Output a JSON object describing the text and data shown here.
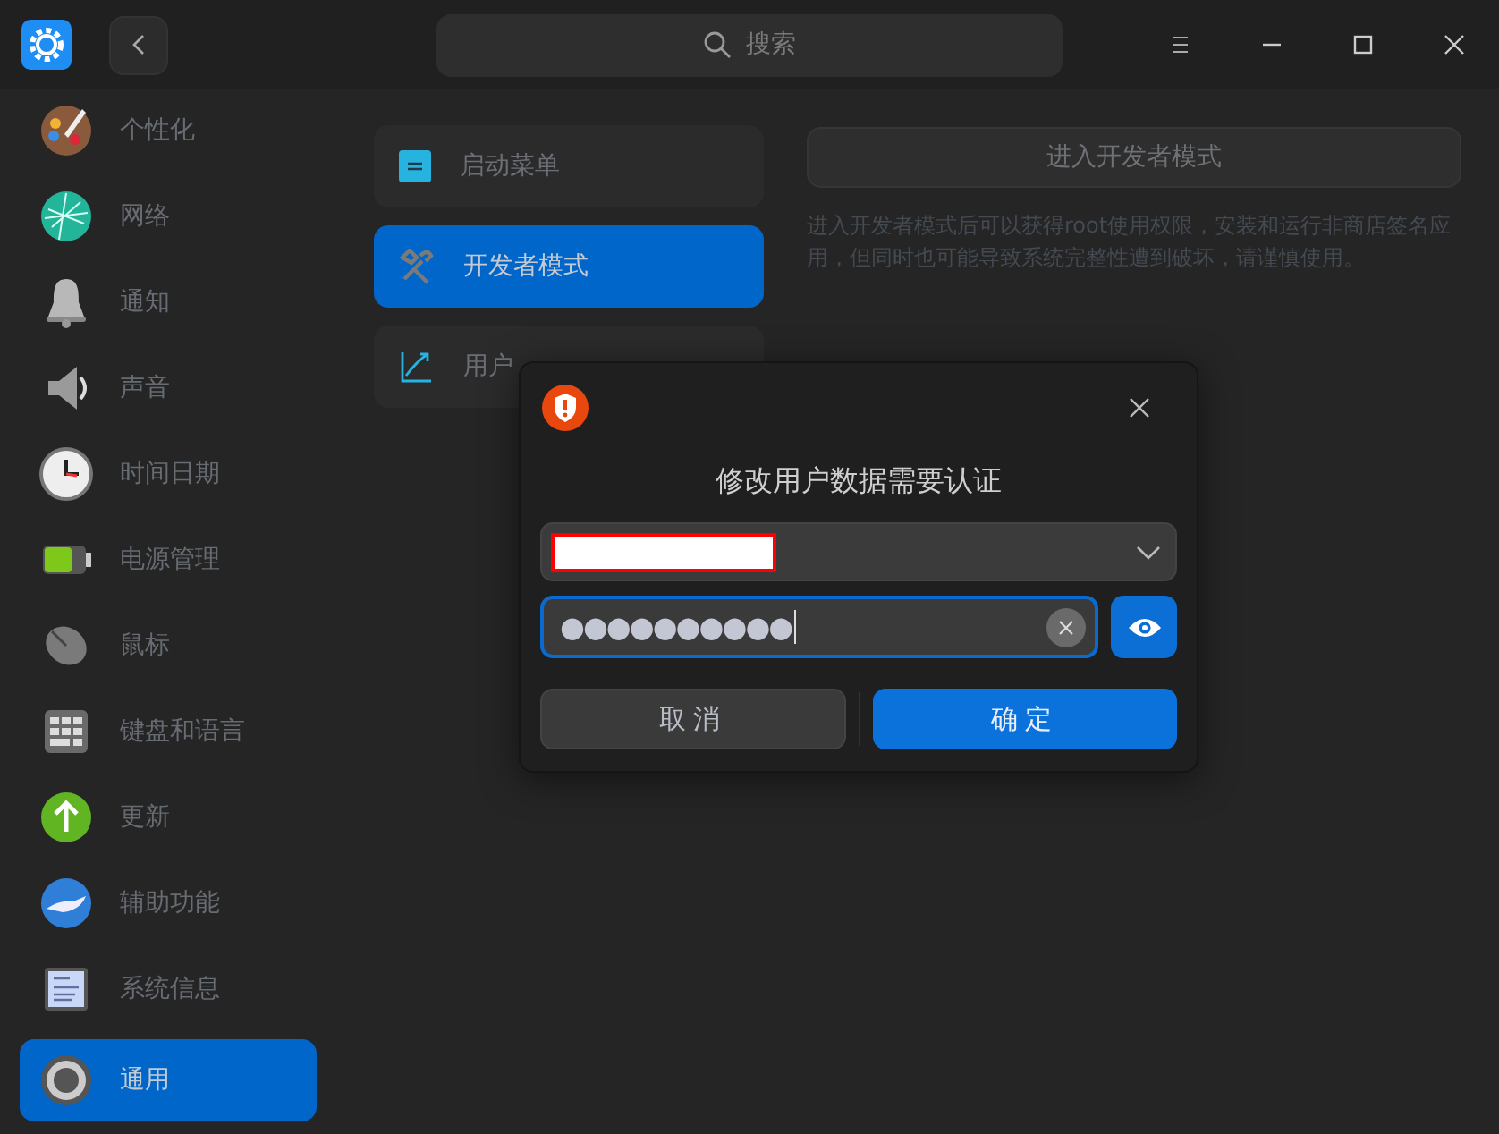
{
  "window": {
    "search": {
      "placeholder": "搜索"
    }
  },
  "sidebar": {
    "items": [
      {
        "label": "个性化",
        "selected": false
      },
      {
        "label": "网络",
        "selected": false
      },
      {
        "label": "通知",
        "selected": false
      },
      {
        "label": "声音",
        "selected": false
      },
      {
        "label": "时间日期",
        "selected": false
      },
      {
        "label": "电源管理",
        "selected": false
      },
      {
        "label": "鼠标",
        "selected": false
      },
      {
        "label": "键盘和语言",
        "selected": false
      },
      {
        "label": "更新",
        "selected": false
      },
      {
        "label": "辅助功能",
        "selected": false
      },
      {
        "label": "系统信息",
        "selected": false
      },
      {
        "label": "通用",
        "selected": true
      }
    ]
  },
  "submenu": {
    "items": [
      {
        "label": "启动菜单",
        "selected": false
      },
      {
        "label": "开发者模式",
        "selected": true
      },
      {
        "label": "用户",
        "selected": false
      }
    ]
  },
  "developer_mode": {
    "button": "进入开发者模式",
    "description": "进入开发者模式后可以获得root使用权限，安装和运行非商店签名应用，但同时也可能导致系统完整性遭到破坏，请谨慎使用。"
  },
  "auth_dialog": {
    "title": "修改用户数据需要认证",
    "password": {
      "value": "●●●●●●●●●●"
    },
    "buttons": [
      {
        "label": "取消",
        "kind": "secondary"
      },
      {
        "label": "确定",
        "kind": "primary"
      }
    ]
  }
}
